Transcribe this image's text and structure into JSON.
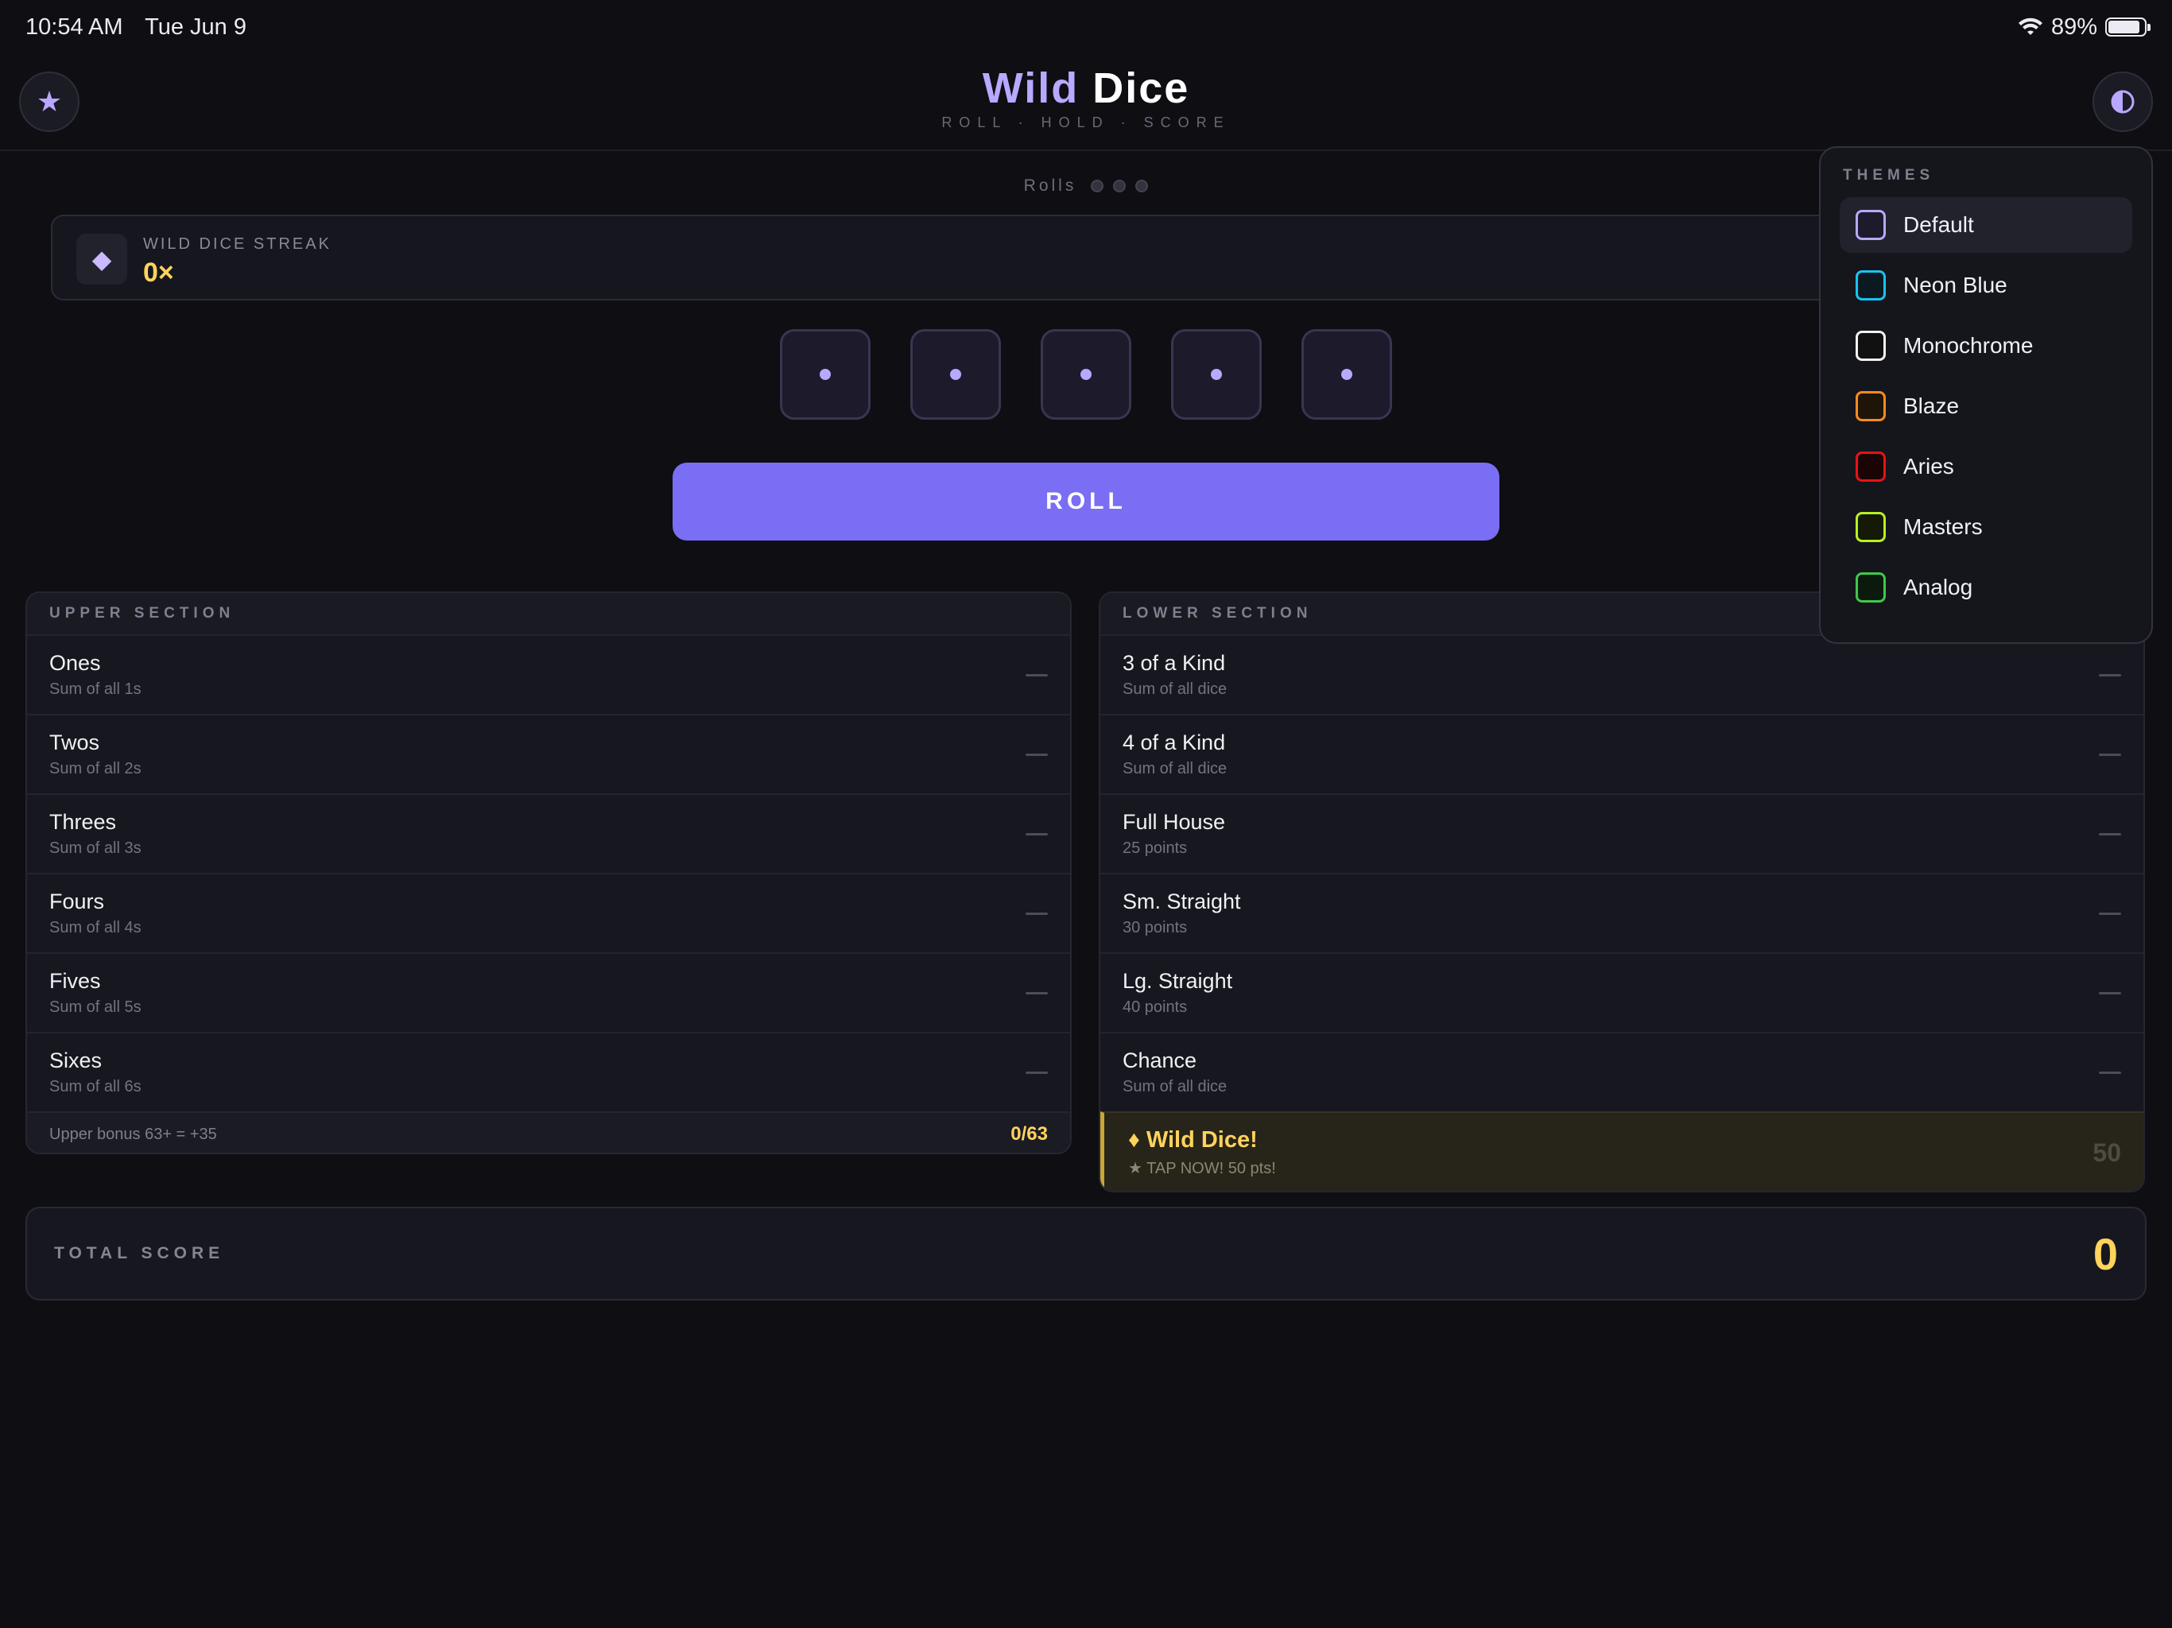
{
  "status": {
    "time": "10:54 AM",
    "date": "Tue Jun 9",
    "battery": "89%",
    "battery_level": 0.89
  },
  "header": {
    "title_part1": "Wild",
    "title_part2": "Dice",
    "subtitle": "ROLL · HOLD · SCORE",
    "favorite_icon": "star-icon",
    "theme_icon": "half-circle-icon"
  },
  "rolls": {
    "label": "Rolls",
    "remaining": 3
  },
  "streak": {
    "label": "WILD DICE STREAK",
    "value": "0×"
  },
  "dice": [
    1,
    1,
    1,
    1,
    1
  ],
  "roll_button": "ROLL",
  "upper": {
    "title": "UPPER SECTION",
    "rows": [
      {
        "name": "Ones",
        "desc": "Sum of all 1s",
        "score": "—"
      },
      {
        "name": "Twos",
        "desc": "Sum of all 2s",
        "score": "—"
      },
      {
        "name": "Threes",
        "desc": "Sum of all 3s",
        "score": "—"
      },
      {
        "name": "Fours",
        "desc": "Sum of all 4s",
        "score": "—"
      },
      {
        "name": "Fives",
        "desc": "Sum of all 5s",
        "score": "—"
      },
      {
        "name": "Sixes",
        "desc": "Sum of all 6s",
        "score": "—"
      }
    ],
    "bonus_label": "Upper bonus  63+ = +35",
    "bonus_value": "0/63"
  },
  "lower": {
    "title": "LOWER SECTION",
    "rows": [
      {
        "name": "3 of a Kind",
        "desc": "Sum of all dice",
        "score": "—"
      },
      {
        "name": "4 of a Kind",
        "desc": "Sum of all dice",
        "score": "—"
      },
      {
        "name": "Full House",
        "desc": "25 points",
        "score": "—"
      },
      {
        "name": "Sm. Straight",
        "desc": "30 points",
        "score": "—"
      },
      {
        "name": "Lg. Straight",
        "desc": "40 points",
        "score": "—"
      },
      {
        "name": "Chance",
        "desc": "Sum of all dice",
        "score": "—"
      }
    ],
    "wild": {
      "name": "♦ Wild Dice!",
      "desc": "★ TAP NOW! 50 pts!",
      "value": "50"
    }
  },
  "total": {
    "label": "TOTAL SCORE",
    "value": "0"
  },
  "themes": {
    "title": "THEMES",
    "items": [
      {
        "name": "Default",
        "color": "#b9a8ff",
        "fill": "#1d1a2b",
        "active": true
      },
      {
        "name": "Neon Blue",
        "color": "#19c3f0",
        "fill": "#0b1a22",
        "active": false
      },
      {
        "name": "Monochrome",
        "color": "#f2f2f2",
        "fill": "#111111",
        "active": false
      },
      {
        "name": "Blaze",
        "color": "#ff8a1c",
        "fill": "#1f1408",
        "active": false
      },
      {
        "name": "Aries",
        "color": "#e51414",
        "fill": "#1a0404",
        "active": false
      },
      {
        "name": "Masters",
        "color": "#b8f021",
        "fill": "#141a06",
        "active": false
      },
      {
        "name": "Analog",
        "color": "#3ec94a",
        "fill": "#0b1a0d",
        "active": false
      }
    ]
  },
  "colors": {
    "accent": "#7a6ef5",
    "gold": "#ffd35c",
    "background": "#0e0e13"
  }
}
